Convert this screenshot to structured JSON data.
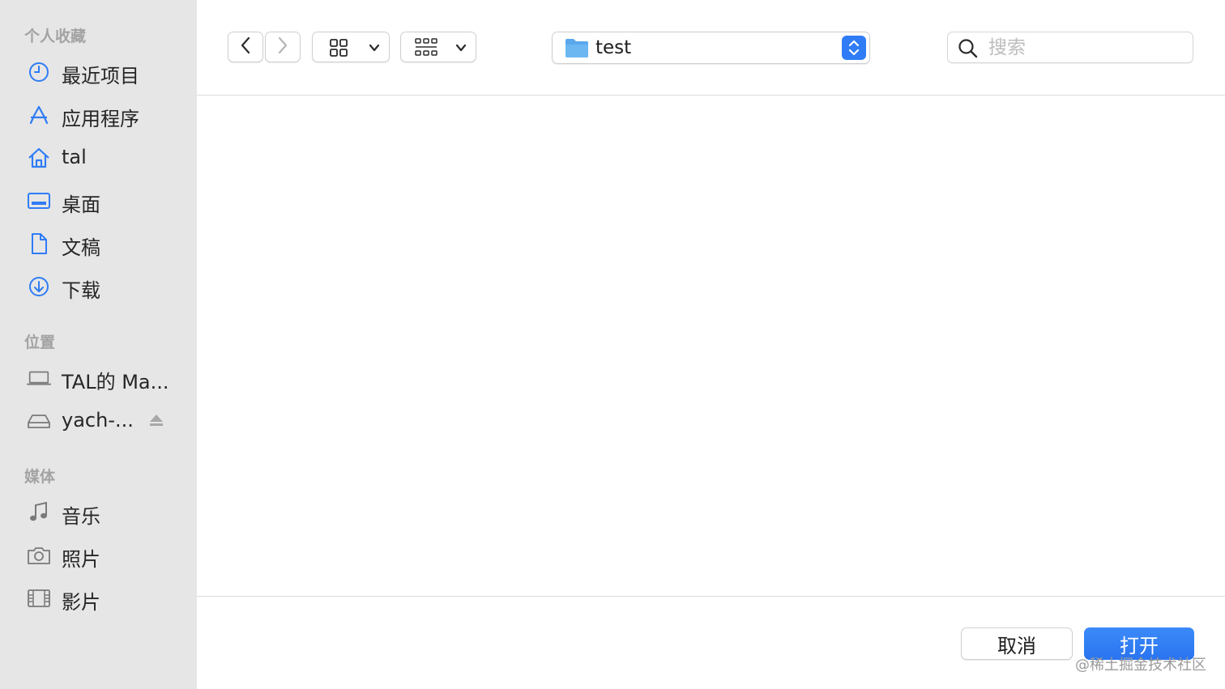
{
  "sidebar": {
    "favorites_title": "个人收藏",
    "favorites": [
      {
        "label": "最近项目",
        "icon": "clock-icon"
      },
      {
        "label": "应用程序",
        "icon": "apps-icon"
      },
      {
        "label": "tal",
        "icon": "home-icon"
      },
      {
        "label": "桌面",
        "icon": "desktop-icon"
      },
      {
        "label": "文稿",
        "icon": "document-icon"
      },
      {
        "label": "下载",
        "icon": "download-icon"
      }
    ],
    "locations_title": "位置",
    "locations": [
      {
        "label": "TAL的 Ma...",
        "icon": "laptop-icon"
      },
      {
        "label": "yach-...",
        "icon": "drive-icon",
        "ejectable": true
      }
    ],
    "media_title": "媒体",
    "media": [
      {
        "label": "音乐",
        "icon": "music-icon"
      },
      {
        "label": "照片",
        "icon": "camera-icon"
      },
      {
        "label": "影片",
        "icon": "film-icon"
      }
    ]
  },
  "toolbar": {
    "current_folder": "test",
    "search_placeholder": "搜索"
  },
  "footer": {
    "cancel_label": "取消",
    "open_label": "打开",
    "watermark": "@稀土掘金技术社区"
  },
  "colors": {
    "accent": "#2f7cf6",
    "sidebar_bg": "#e6e6e6",
    "icon_blue": "#2f7cf6",
    "folder_blue": "#5aa8ec"
  }
}
